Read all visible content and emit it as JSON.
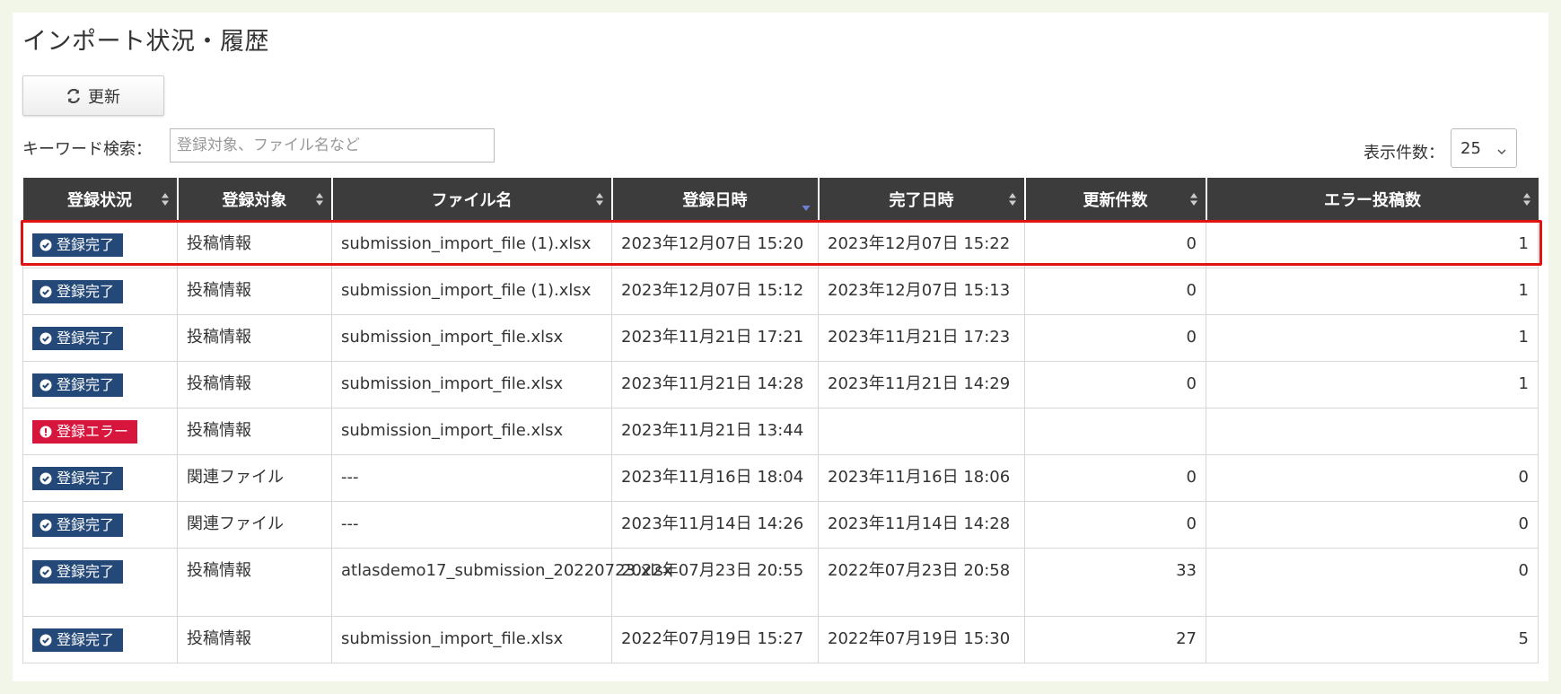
{
  "page": {
    "title": "インポート状況・履歴"
  },
  "toolbar": {
    "refresh_label": "更新"
  },
  "search": {
    "label": "キーワード検索：",
    "placeholder": "登録対象、ファイル名など",
    "value": ""
  },
  "pagination": {
    "label": "表示件数：",
    "selected": "25"
  },
  "table": {
    "headers": [
      "登録状況",
      "登録対象",
      "ファイル名",
      "登録日時",
      "完了日時",
      "更新件数",
      "エラー投稿数"
    ],
    "rows": [
      {
        "status": "登録完了",
        "status_type": "ok",
        "target": "投稿情報",
        "file": "submission_import_file (1).xlsx",
        "file_link": true,
        "registered": "2023年12月07日 15:20",
        "completed": "2023年12月07日 15:22",
        "updated": "0",
        "errors": "1",
        "errors_link": true
      },
      {
        "status": "登録完了",
        "status_type": "ok",
        "target": "投稿情報",
        "file": "submission_import_file (1).xlsx",
        "file_link": true,
        "registered": "2023年12月07日 15:12",
        "completed": "2023年12月07日 15:13",
        "updated": "0",
        "errors": "1",
        "errors_link": true
      },
      {
        "status": "登録完了",
        "status_type": "ok",
        "target": "投稿情報",
        "file": "submission_import_file.xlsx",
        "file_link": true,
        "registered": "2023年11月21日 17:21",
        "completed": "2023年11月21日 17:23",
        "updated": "0",
        "errors": "1",
        "errors_link": true
      },
      {
        "status": "登録完了",
        "status_type": "ok",
        "target": "投稿情報",
        "file": "submission_import_file.xlsx",
        "file_link": true,
        "registered": "2023年11月21日 14:28",
        "completed": "2023年11月21日 14:29",
        "updated": "0",
        "errors": "1",
        "errors_link": true
      },
      {
        "status": "登録エラー",
        "status_type": "err",
        "target": "投稿情報",
        "file": "submission_import_file.xlsx",
        "file_link": true,
        "registered": "2023年11月21日 13:44",
        "completed": "",
        "updated": "",
        "errors": "",
        "errors_link": false
      },
      {
        "status": "登録完了",
        "status_type": "ok",
        "target": "関連ファイル",
        "file": "---",
        "file_link": false,
        "registered": "2023年11月16日 18:04",
        "completed": "2023年11月16日 18:06",
        "updated": "0",
        "errors": "0",
        "errors_link": false
      },
      {
        "status": "登録完了",
        "status_type": "ok",
        "target": "関連ファイル",
        "file": "---",
        "file_link": false,
        "registered": "2023年11月14日 14:26",
        "completed": "2023年11月14日 14:28",
        "updated": "0",
        "errors": "0",
        "errors_link": false
      },
      {
        "status": "登録完了",
        "status_type": "ok",
        "target": "投稿情報",
        "file": "atlasdemo17_submission_20220723.xlsx",
        "file_link": true,
        "registered": "2022年07月23日 20:55",
        "completed": "2022年07月23日 20:58",
        "updated": "33",
        "errors": "0",
        "errors_link": false
      },
      {
        "status": "登録完了",
        "status_type": "ok",
        "target": "投稿情報",
        "file": "submission_import_file.xlsx",
        "file_link": true,
        "registered": "2022年07月19日 15:27",
        "completed": "2022年07月19日 15:30",
        "updated": "27",
        "errors": "5",
        "errors_link": true
      }
    ]
  },
  "colors": {
    "header_bg": "#3c3c3c",
    "badge_ok": "#244979",
    "badge_err": "#d6163c",
    "link": "#1a56c8",
    "highlight": "#e01212",
    "page_bg": "#f2f6e8"
  },
  "icons": {
    "refresh": "refresh-icon",
    "ok": "check-circle-icon",
    "err": "exclamation-circle-icon",
    "sort": "sort-icon",
    "sort_desc": "sort-desc-icon",
    "select": "chevron-down-icon"
  }
}
